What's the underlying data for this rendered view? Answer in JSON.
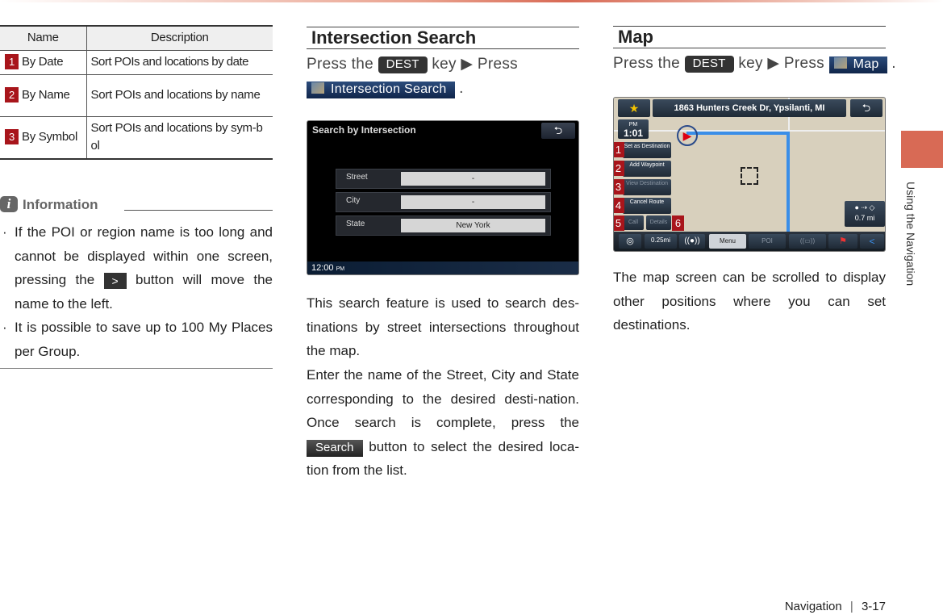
{
  "sort_table": {
    "headers": [
      "Name",
      "Description"
    ],
    "rows": [
      {
        "num": "1",
        "name": "By Date",
        "desc": "Sort POIs and locations by date"
      },
      {
        "num": "2",
        "name": "By Name",
        "desc": "Sort POIs and locations by name"
      },
      {
        "num": "3",
        "name": "By Symbol",
        "desc": "Sort POIs and locations by sym-bol"
      }
    ]
  },
  "information": {
    "icon": "info-icon",
    "title": "Information",
    "bullet1_a": "If the POI or region name is too long and cannot be displayed within one screen, pressing the",
    "bullet1_btn": ">",
    "bullet1_b": "button will move the name to the left.",
    "bullet2": "It is possible to save up to 100 My Places per Group."
  },
  "intersection": {
    "title": "Intersection Search",
    "press1": "Press the",
    "key": "DEST",
    "press2": "key ▶ Press",
    "menu_btn": "Intersection Search",
    "period": ".",
    "screen": {
      "title": "Search by Intersection",
      "back": "⮌",
      "fields": [
        {
          "label": "Street",
          "value": "-"
        },
        {
          "label": "City",
          "value": "-"
        },
        {
          "label": "State",
          "value": "New York"
        }
      ],
      "clock": "12:00",
      "ampm": "PM"
    },
    "para1": "This search feature is used to search des-tinations by street intersections throughout the map.",
    "para2_a": "Enter the name of the Street, City and State corresponding to the desired desti-nation. Once search is complete, press the",
    "search_btn": "Search",
    "para2_b": "button to select the desired loca-tion from the list."
  },
  "map": {
    "title": "Map",
    "press1": "Press the",
    "key": "DEST",
    "press2": "key ▶ Press",
    "menu_btn": "Map",
    "period": ".",
    "screen": {
      "address": "1863 Hunters Creek Dr, Ypsilanti, MI",
      "ampm": "PM",
      "time": "1:01",
      "buttons": [
        {
          "num": "1",
          "label": "Set as Destination"
        },
        {
          "num": "2",
          "label": "Add Waypoint"
        },
        {
          "num": "3",
          "label": "View Destination"
        },
        {
          "num": "4",
          "label": "Cancel Route"
        },
        {
          "num": "5",
          "label": "Call"
        },
        {
          "num": "6",
          "label": "Details"
        }
      ],
      "distance": "0.7 mi",
      "scale": "0.25mi",
      "menu": "Menu",
      "poi": "POI"
    },
    "para": "The map screen can be scrolled to display other positions where you can set destinations."
  },
  "side_tab": "Using the Navigation",
  "footer": {
    "section": "Navigation",
    "page": "3-17"
  },
  "colors": {
    "accent": "#d86a55",
    "number_badge": "#a8151b"
  }
}
